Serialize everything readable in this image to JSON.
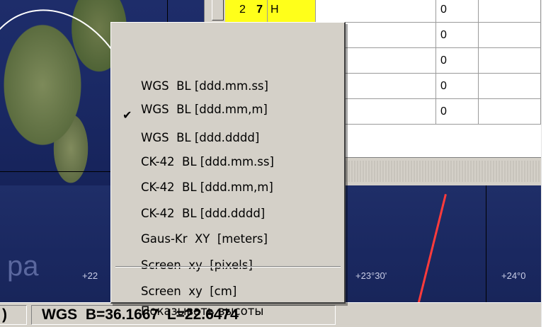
{
  "table": {
    "rows": [
      {
        "num": "2",
        "num2": "7",
        "h": "H",
        "value": "0"
      },
      {
        "num": "",
        "num2": "",
        "h": "",
        "value": "0"
      },
      {
        "num": "",
        "num2": "",
        "h": "",
        "value": "0"
      },
      {
        "num": "",
        "num2": "",
        "h": "",
        "value": "0"
      },
      {
        "num": "",
        "num2": "",
        "h": "",
        "value": "0"
      }
    ]
  },
  "map": {
    "tick_labels": [
      "+22",
      "+23°30'",
      "+24°0"
    ],
    "watermark": "pa"
  },
  "context_menu": {
    "items": [
      {
        "label": "WGS  BL [ddd.mm.ss]",
        "checked": false
      },
      {
        "label": "WGS  BL [ddd.mm,m]",
        "checked": false
      },
      {
        "label": "WGS  BL [ddd.dddd]",
        "checked": true
      },
      {
        "label": "CK-42  BL [ddd.mm.ss]",
        "checked": false
      },
      {
        "label": "CK-42  BL [ddd.mm,m]",
        "checked": false
      },
      {
        "label": "CK-42  BL [ddd.dddd]",
        "checked": false
      },
      {
        "label": "Gaus-Kr  XY  [meters]",
        "checked": false
      },
      {
        "label": "Screen  xy  [pixels]",
        "checked": false
      },
      {
        "label": "Screen  xy  [cm]",
        "checked": false
      }
    ],
    "extra_item": "Показывать высоты",
    "check_glyph": "✔"
  },
  "status": {
    "left_fragment": ")",
    "coords": "WGS  B=36.1667  L=22.6474"
  },
  "colors": {
    "table_yellow": "#ffff1a",
    "menu_bg": "#d4d0c8",
    "map_red_line": "#ff3b3b"
  }
}
